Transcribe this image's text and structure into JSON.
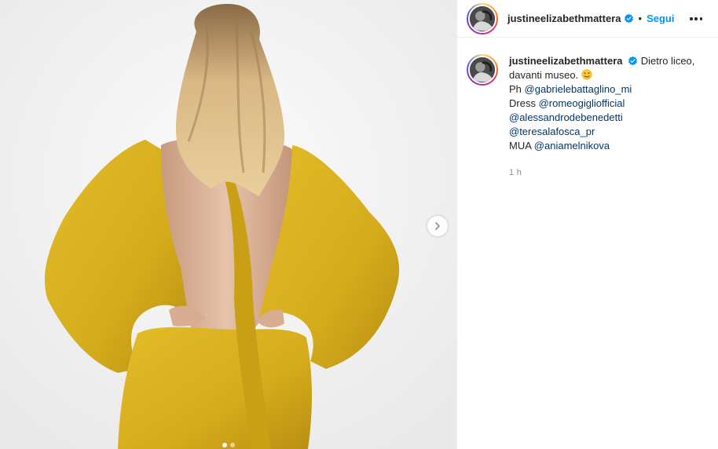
{
  "post": {
    "username": "justineelizabethmattera",
    "follow_label": "Segui",
    "separator": "•",
    "caption": {
      "first_line": "Dietro liceo,",
      "second_line": "davanti museo.",
      "emoji": "winking-face-with-tongue",
      "credits": [
        {
          "prefix": "Ph ",
          "mention": "@gabrielebattaglino_mi"
        },
        {
          "prefix": "Dress ",
          "mention": "@romeogigliofficial"
        },
        {
          "prefix": "",
          "mention": "@alessandrodebenedetti"
        },
        {
          "prefix": "",
          "mention": "@teresalafosca_pr"
        },
        {
          "prefix": "MUA ",
          "mention": "@aniamelnikova"
        }
      ]
    },
    "timestamp": "1 h",
    "media": {
      "description_icon": "photo-woman-yellow-dress",
      "carousel_count": 2,
      "carousel_active": 0
    }
  },
  "colors": {
    "accent": "#0095f6",
    "mention": "#00376b",
    "dress": "#d9b21c",
    "muted": "#8e8e8e"
  }
}
